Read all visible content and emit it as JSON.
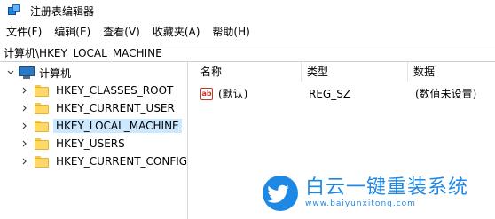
{
  "window": {
    "title": "注册表编辑器"
  },
  "menu": [
    "文件(F)",
    "编辑(E)",
    "查看(V)",
    "收藏夹(A)",
    "帮助(H)"
  ],
  "address": "计算机\\HKEY_LOCAL_MACHINE",
  "tree": {
    "root": "计算机",
    "items": [
      {
        "label": "HKEY_CLASSES_ROOT",
        "selected": false
      },
      {
        "label": "HKEY_CURRENT_USER",
        "selected": false
      },
      {
        "label": "HKEY_LOCAL_MACHINE",
        "selected": true
      },
      {
        "label": "HKEY_USERS",
        "selected": false
      },
      {
        "label": "HKEY_CURRENT_CONFIG",
        "selected": false
      }
    ]
  },
  "list": {
    "columns": [
      "名称",
      "类型",
      "数据"
    ],
    "rows": [
      {
        "name": "(默认)",
        "type": "REG_SZ",
        "data": "(数值未设置)",
        "icon": "ab-string-icon"
      }
    ]
  },
  "watermark": {
    "title": "白云一键重装系统",
    "url": "www.baiyunxitong.com"
  },
  "colors": {
    "selection": "#cce8ff",
    "watermark": "#1e88e5"
  }
}
